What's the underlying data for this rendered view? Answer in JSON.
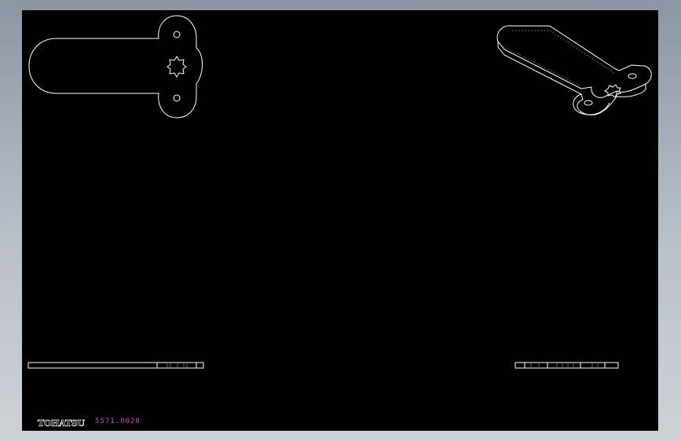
{
  "drawing": {
    "logo_text": "TOHATSU",
    "part_number": "5571.0020",
    "background_color": "#000000",
    "line_color": "#ffffff",
    "hidden_line_color": "#1f8a2a",
    "part_number_color": "#e040e0"
  }
}
